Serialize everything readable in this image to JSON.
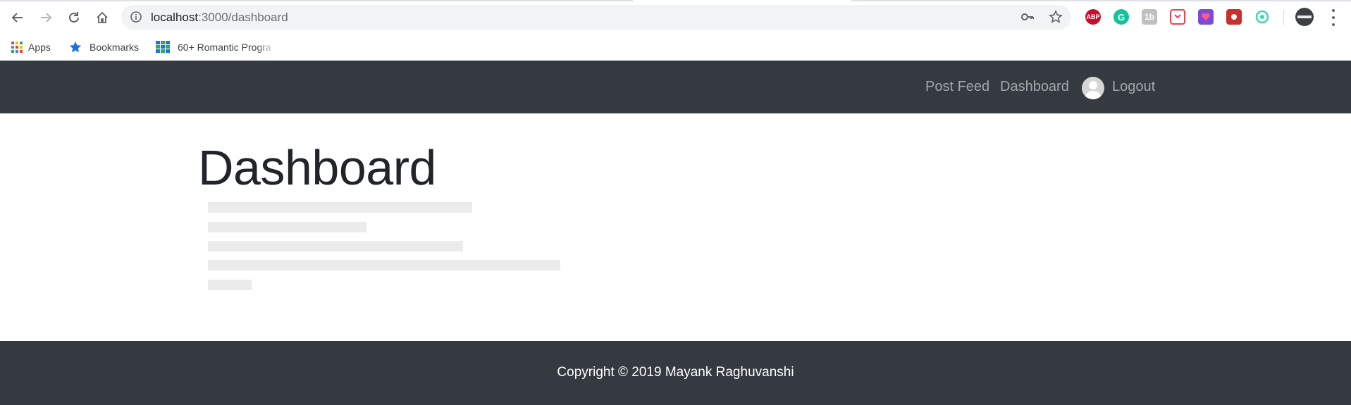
{
  "browser": {
    "url_host": "localhost",
    "url_path": ":3000/dashboard",
    "extensions": [
      {
        "name": "adblock-plus",
        "label": "ABP",
        "color": "#c70d2c"
      },
      {
        "name": "grammarly",
        "label": "G",
        "color": "#15c39a"
      },
      {
        "name": "ext-1b",
        "label": "1b",
        "color": "#c0c0c0"
      },
      {
        "name": "pocket",
        "label": "",
        "color": "#ef4056"
      },
      {
        "name": "ext-purple",
        "label": "",
        "color": "#7b4bd6"
      },
      {
        "name": "ext-red",
        "label": "",
        "color": "#c9302c"
      },
      {
        "name": "ext-teal",
        "label": "",
        "color": "#3ed6b0"
      }
    ]
  },
  "bookmarks": {
    "apps": "Apps",
    "bookmarks": "Bookmarks",
    "item3": "60+ Romantic Progra"
  },
  "navbar": {
    "post_feed": "Post Feed",
    "dashboard": "Dashboard",
    "logout": "Logout",
    "bg_color": "#343a40"
  },
  "main": {
    "title": "Dashboard"
  },
  "footer": {
    "text": "Copyright © 2019 Mayank Raghuvanshi"
  }
}
